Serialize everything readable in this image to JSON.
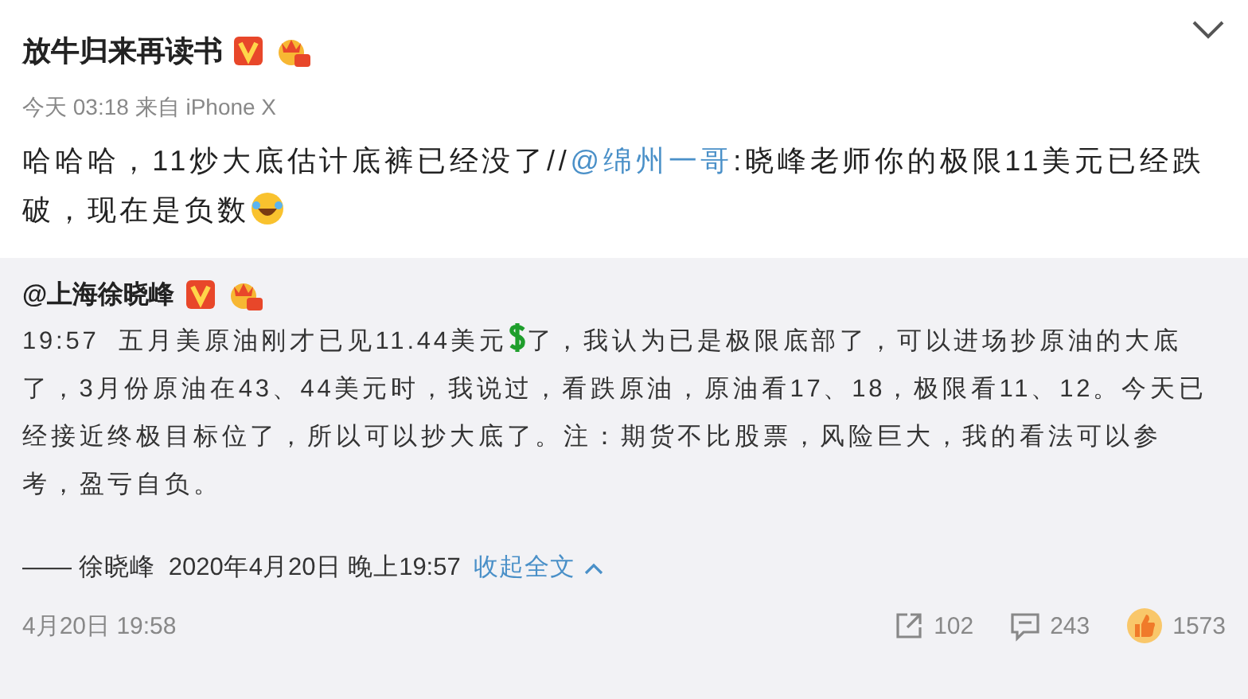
{
  "post": {
    "author": "放牛归来再读书",
    "meta": "今天 03:18 来自 iPhone X",
    "body": [
      {
        "kind": "text",
        "text": "哈哈哈，11炒大底估计底裤已经没了//"
      },
      {
        "kind": "mention",
        "text": "@绵州一哥"
      },
      {
        "kind": "text",
        "text": ":晓峰老师你的极限11美元已经跌破，现在是负数"
      },
      {
        "kind": "emoji"
      }
    ]
  },
  "repost": {
    "author": "@上海徐晓峰",
    "body": [
      {
        "kind": "text",
        "text": "19:57  五月美原油刚才已见11.44美元"
      },
      {
        "kind": "emoji"
      },
      {
        "kind": "text",
        "text": "了，我认为已是极限底部了，可以进场抄原油的大底了，3月份原油在43、44美元时，我说过，看跌原油，原油看17、18，极限看11、12。今天已经接近终极目标位了，所以可以抄大底了。注：期货不比股票，风险巨大，我的看法可以参考，盈亏自负。"
      }
    ],
    "signature": "—— 徐晓峰  2020年4月20日 晚上19:57",
    "collapse": "收起全文",
    "date": "4月20日 19:58",
    "stats": [
      {
        "kind": "share",
        "count": "102"
      },
      {
        "kind": "comment",
        "count": "243"
      },
      {
        "kind": "like",
        "count": "1573"
      }
    ]
  }
}
